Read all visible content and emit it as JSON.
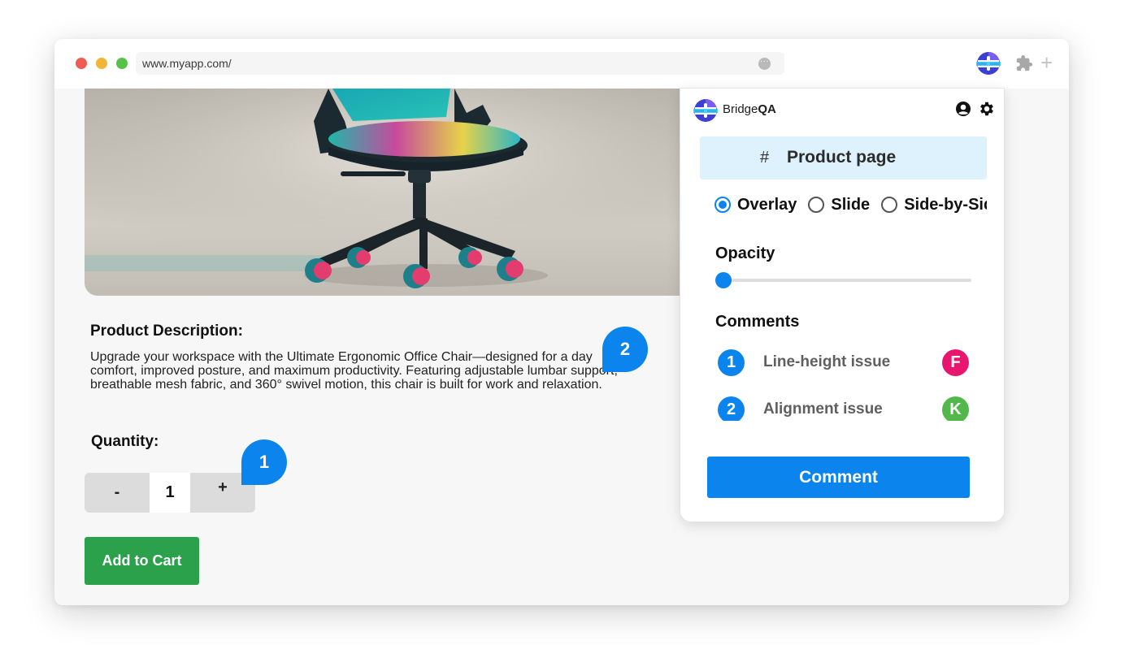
{
  "browser": {
    "url": "www.myapp.com/",
    "url_menu_icon": "more-icon",
    "extensions": [
      "bridgeqa-logo-icon",
      "puzzle-icon",
      "plus-icon"
    ]
  },
  "product": {
    "description_title": "Product Description:",
    "description_text": "Upgrade your workspace with the Ultimate Ergonomic Office Chair—designed for a day comfort, improved posture, and maximum productivity. Featuring adjustable lumbar support, breathable mesh fabric, and 360° swivel motion, this chair is built for work and relaxation.",
    "quantity_title": "Quantity:",
    "quantity_minus": "-",
    "quantity_value": "1",
    "quantity_plus": "+",
    "add_to_cart": "Add to Cart"
  },
  "pins": [
    {
      "number": "1"
    },
    {
      "number": "2"
    }
  ],
  "panel": {
    "brand_prefix": "Bridge",
    "brand_suffix": "QA",
    "page_hash": "#",
    "page_name": "Product page",
    "modes": [
      {
        "label": "Overlay",
        "selected": true
      },
      {
        "label": "Slide",
        "selected": false
      },
      {
        "label": "Side-by-Side",
        "selected": false
      }
    ],
    "opacity_label": "Opacity",
    "opacity_value": 0,
    "comments_label": "Comments",
    "comments": [
      {
        "number": "1",
        "text": "Line-height issue",
        "avatar": "F",
        "avatar_color": "#e8166f"
      },
      {
        "number": "2",
        "text": "Alignment issue",
        "avatar": "K",
        "avatar_color": "#53b84b"
      }
    ],
    "comment_button": "Comment"
  },
  "colors": {
    "accent": "#0b84ee",
    "add_to_cart": "#2aa14a",
    "page_chip": "#def2fd"
  }
}
